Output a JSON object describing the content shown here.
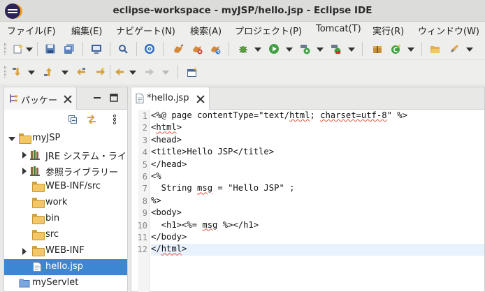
{
  "window": {
    "title": "eclipse-workspace - myJSP/hello.jsp - Eclipse IDE"
  },
  "menu": [
    "ファイル(F)",
    "編集(E)",
    "ナビゲート(N)",
    "検索(A)",
    "プロジェクト(P)",
    "Tomcat(T)",
    "実行(R)",
    "ウィンドウ(W)"
  ],
  "explorer": {
    "tab_label": "パッケー",
    "tree": [
      {
        "label": "myJSP",
        "depth": 0,
        "expanded": true,
        "icon": "project-folder-icon"
      },
      {
        "label": "JRE システム・ライ",
        "depth": 1,
        "expanded": false,
        "icon": "library-icon"
      },
      {
        "label": "参照ライブラリー",
        "depth": 1,
        "expanded": false,
        "icon": "library-icon"
      },
      {
        "label": "WEB-INF/src",
        "depth": 1,
        "icon": "source-folder-icon"
      },
      {
        "label": "work",
        "depth": 1,
        "icon": "folder-icon"
      },
      {
        "label": "bin",
        "depth": 1,
        "icon": "folder-icon"
      },
      {
        "label": "src",
        "depth": 1,
        "icon": "folder-icon"
      },
      {
        "label": "WEB-INF",
        "depth": 1,
        "expanded": false,
        "icon": "folder-icon"
      },
      {
        "label": "hello.jsp",
        "depth": 1,
        "selected": true,
        "icon": "jsp-file-icon"
      },
      {
        "label": "myServlet",
        "depth": 0,
        "icon": "project-folder-icon"
      }
    ]
  },
  "editor": {
    "tab_label": "*hello.jsp",
    "lines": [
      {
        "n": "1",
        "text": "<%@ page contentType=\"text/html; charset=utf-8\" %>"
      },
      {
        "n": "2",
        "text": "<html>"
      },
      {
        "n": "3",
        "text": "<head>"
      },
      {
        "n": "4",
        "text": "<title>Hello JSP</title>"
      },
      {
        "n": "5",
        "text": "</head>"
      },
      {
        "n": "6",
        "text": "<%"
      },
      {
        "n": "7",
        "text": "  String msg = \"Hello JSP\" ;"
      },
      {
        "n": "8",
        "text": "%>"
      },
      {
        "n": "9",
        "text": "<body>"
      },
      {
        "n": "10",
        "text": "  <h1><%= msg %></h1>"
      },
      {
        "n": "11",
        "text": "</body>"
      },
      {
        "n": "12",
        "text": "</html>"
      }
    ],
    "current_line": 12
  },
  "colors": {
    "accent": "#3d86d4",
    "current_line": "#e8f2fe",
    "warning_underline": "#e8553c"
  }
}
